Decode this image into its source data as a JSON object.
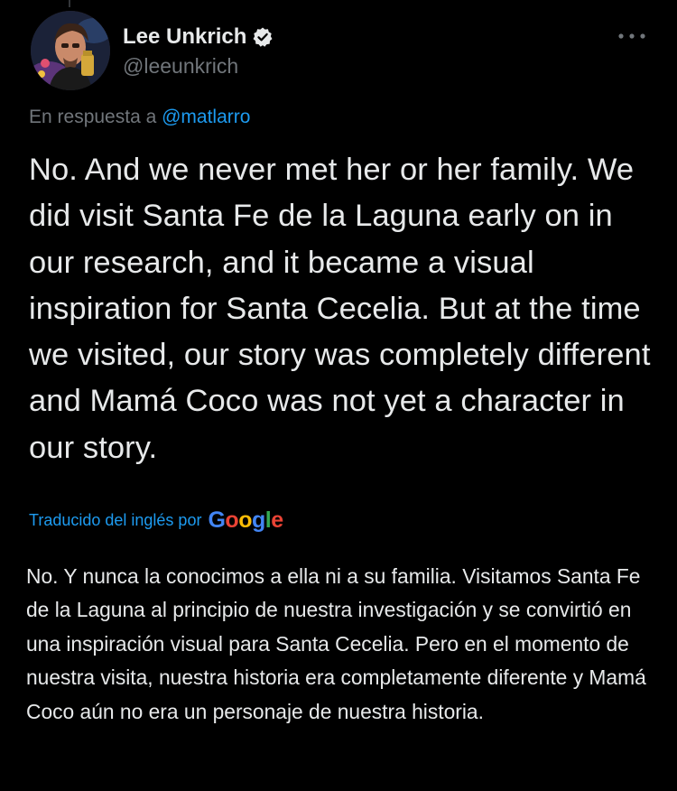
{
  "tweet": {
    "author": {
      "display_name": "Lee Unkrich",
      "handle": "@leeunkrich",
      "verified": true
    },
    "reply_prefix": "En respuesta a",
    "reply_to": "@matlarro",
    "text": "No. And we never met her or her family. We did visit Santa Fe de la Laguna early on in our research, and it became a visual inspiration for Santa Cecelia. But at the time we visited, our story was completely different and Mamá Coco was not yet a character in our story.",
    "translation": {
      "label": "Traducido del inglés por",
      "provider": "Google",
      "text": "No. Y nunca la conocimos a ella ni a su familia. Visitamos Santa Fe de la Laguna al principio de nuestra investigación y se convirtió en una inspiración visual para Santa Cecelia. Pero en el momento de nuestra visita, nuestra historia era completamente diferente y Mamá Coco aún no era un personaje de nuestra historia."
    }
  },
  "icons": {
    "more": "more-horizontal-icon",
    "verified": "verified-badge-icon",
    "avatar": "avatar-photo"
  },
  "colors": {
    "background": "#000000",
    "text": "#e7e9ea",
    "secondary_text": "#71767b",
    "accent": "#1d9bf0"
  }
}
